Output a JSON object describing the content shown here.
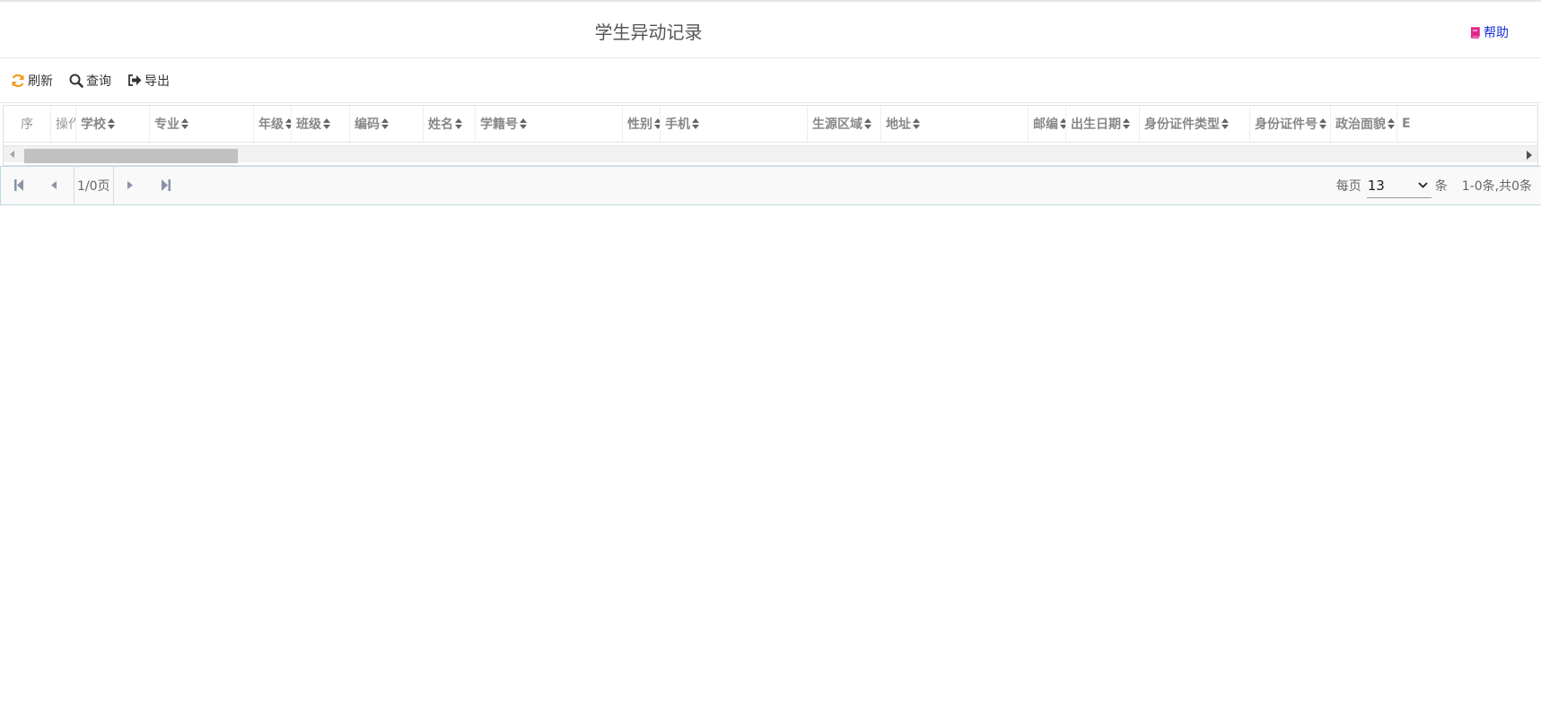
{
  "header": {
    "title": "学生异动记录",
    "help_label": "帮助"
  },
  "toolbar": {
    "refresh_label": "刷新",
    "query_label": "查询",
    "export_label": "导出"
  },
  "table": {
    "columns": [
      "序",
      "操作",
      "学校",
      "专业",
      "年级",
      "班级",
      "编码",
      "姓名",
      "学籍号",
      "性别",
      "手机",
      "生源区域",
      "地址",
      "邮编",
      "出生日期",
      "身份证件类型",
      "身份证件号",
      "政治面貌",
      "E"
    ]
  },
  "pager": {
    "page_info": "1/0页",
    "per_page_label": "每页",
    "per_page_value": "13",
    "per_page_unit": "条",
    "total_text": "1-0条,共0条"
  },
  "colors": {
    "help": "#1a2fd6",
    "help_icon": "#e0288a",
    "refresh_icon": "#f29a1c",
    "pager_border": "#b9dde2"
  }
}
